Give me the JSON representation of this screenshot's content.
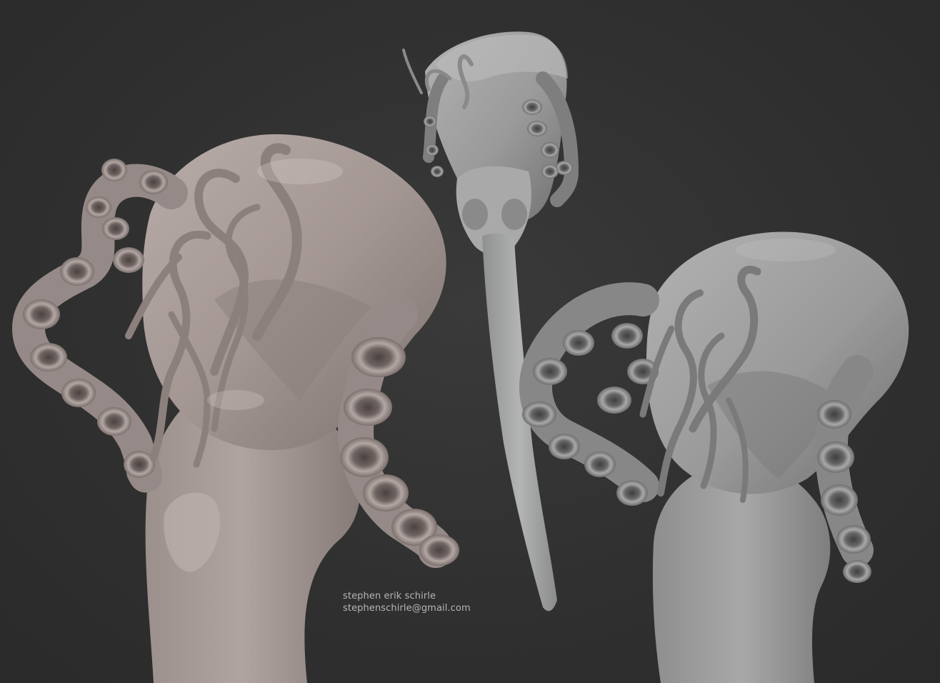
{
  "image": {
    "background_color": "#2e2e2e",
    "clay_color_warm": "#a79a96",
    "clay_color_gray": "#9c9c9c",
    "subjects": [
      "sculpt-view-left",
      "sculpt-view-center",
      "sculpt-view-right"
    ]
  },
  "credit": {
    "name": "stephen erik schirle",
    "email": "stephenschirle@gmail.com"
  }
}
